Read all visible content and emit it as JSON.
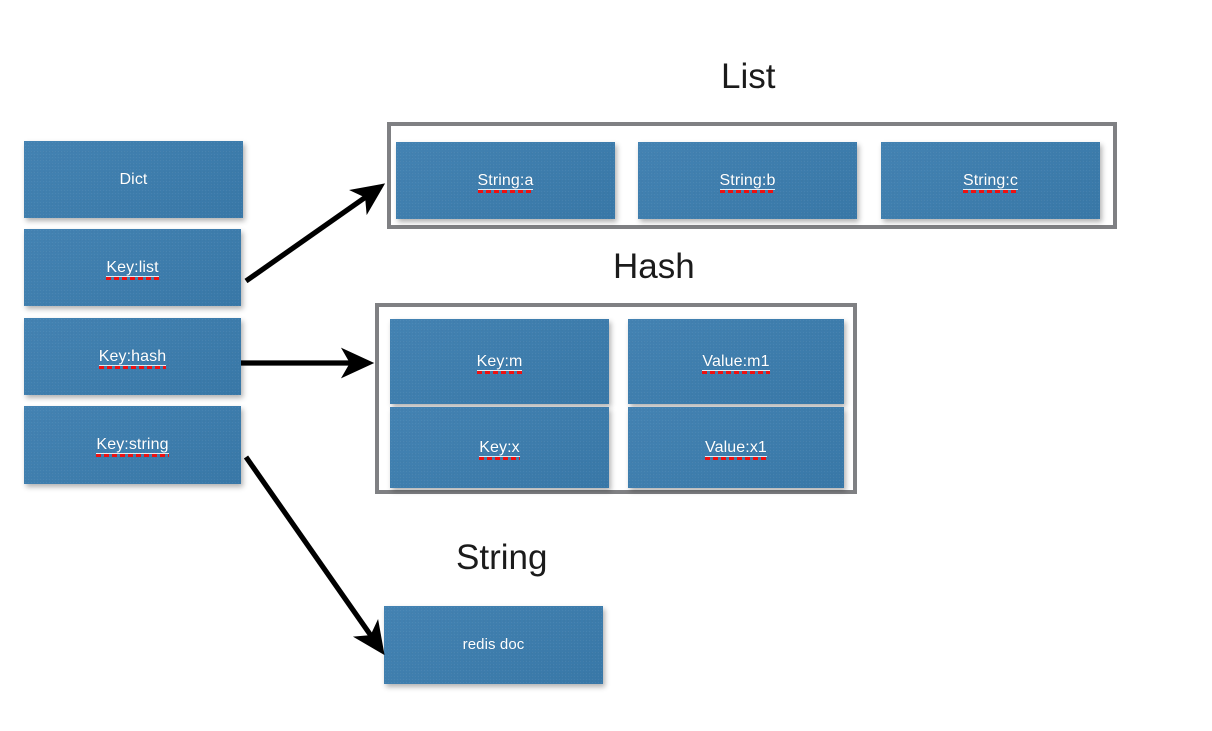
{
  "diagram": {
    "background": "#ffffff",
    "box_color": "#3b7daf",
    "frame_color": "#7f8083",
    "text_color": "#ffffff",
    "title_color": "#1b1b1b",
    "spellcheck_underline_color": "#ee1111",
    "arrow_color": "#000000"
  },
  "titles": {
    "list": "List",
    "hash": "Hash",
    "string": "String"
  },
  "left_column": {
    "boxes": [
      {
        "label": "Dict",
        "spellcheck": false
      },
      {
        "label": "Key:list",
        "spellcheck": true
      },
      {
        "label": "Key:hash",
        "spellcheck": true
      },
      {
        "label": "Key:string",
        "spellcheck": true
      }
    ]
  },
  "list_group": {
    "title": "List",
    "items": [
      {
        "label": "String:a",
        "spellcheck": true
      },
      {
        "label": "String:b",
        "spellcheck": true
      },
      {
        "label": "String:c",
        "spellcheck": true
      }
    ]
  },
  "hash_group": {
    "title": "Hash",
    "rows": [
      {
        "key": "Key:m",
        "value": "Value:m1",
        "spellcheck": true
      },
      {
        "key": "Key:x",
        "value": "Value:x1",
        "spellcheck": true
      }
    ]
  },
  "string_group": {
    "title": "String",
    "item": {
      "label": "redis doc",
      "spellcheck": false
    }
  },
  "arrows": [
    {
      "name": "arrow-key-list-to-list",
      "from": "Key:list",
      "to": "List"
    },
    {
      "name": "arrow-key-hash-to-hash",
      "from": "Key:hash",
      "to": "Hash"
    },
    {
      "name": "arrow-key-string-to-string",
      "from": "Key:string",
      "to": "String"
    }
  ]
}
